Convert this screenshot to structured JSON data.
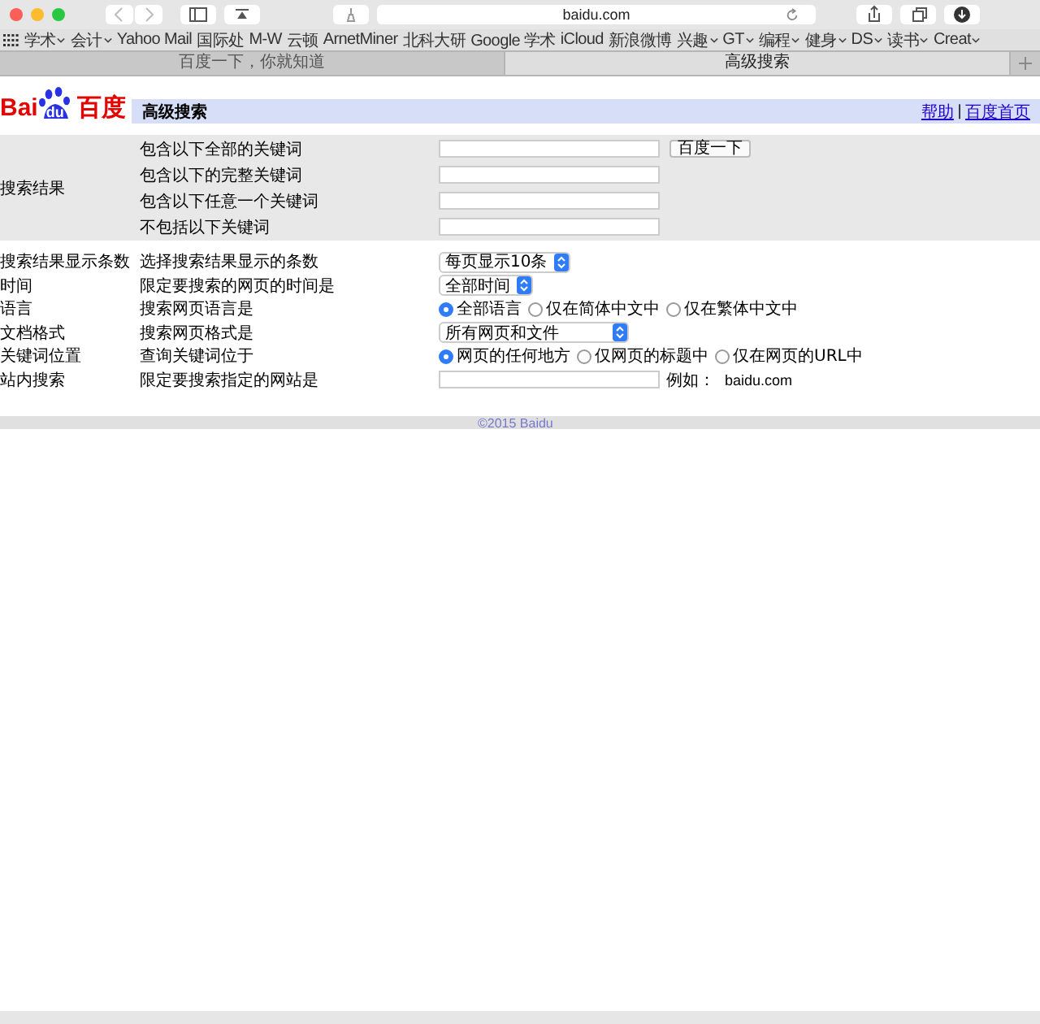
{
  "browser": {
    "url": "baidu.com"
  },
  "bookmarks": [
    {
      "label": "学术",
      "menu": true
    },
    {
      "label": "会计",
      "menu": true
    },
    {
      "label": "Yahoo Mail",
      "menu": false
    },
    {
      "label": "国际处",
      "menu": false
    },
    {
      "label": "M-W",
      "menu": false
    },
    {
      "label": "云顿",
      "menu": false
    },
    {
      "label": "ArnetMiner",
      "menu": false
    },
    {
      "label": "北科大研",
      "menu": false
    },
    {
      "label": "Google 学术",
      "menu": false
    },
    {
      "label": "iCloud",
      "menu": false
    },
    {
      "label": "新浪微博",
      "menu": false
    },
    {
      "label": "兴趣",
      "menu": true
    },
    {
      "label": "GT",
      "menu": true
    },
    {
      "label": "编程",
      "menu": true
    },
    {
      "label": "健身",
      "menu": true
    },
    {
      "label": "DS",
      "menu": true
    },
    {
      "label": "读书",
      "menu": true
    },
    {
      "label": "Creat",
      "menu": true
    }
  ],
  "tabs": [
    {
      "label": "百度一下，你就知道",
      "selected": false
    },
    {
      "label": "高级搜索",
      "selected": true
    }
  ],
  "logo": {
    "text_1": "Bai",
    "text_2": "du",
    "text_3": "百度"
  },
  "header": {
    "title": "高级搜索",
    "links": [
      "帮助",
      "百度首页"
    ],
    "separator": "|"
  },
  "keywords": {
    "label": "搜索结果",
    "button": "百度一下",
    "rows": [
      {
        "label": "包含以下全部的关键词"
      },
      {
        "label": "包含以下的完整关键词"
      },
      {
        "label": "包含以下任意一个关键词"
      },
      {
        "label": "不包括以下关键词"
      }
    ]
  },
  "options": [
    {
      "label": "搜索结果显示条数",
      "description": "选择搜索结果显示的条数",
      "kind": "select",
      "value": "每页显示10条"
    },
    {
      "label": "时间",
      "description": "限定要搜索的网页的时间是",
      "kind": "select",
      "value": "全部时间"
    },
    {
      "label": "语言",
      "description": "搜索网页语言是",
      "kind": "radio",
      "choices": [
        {
          "label": "全部语言",
          "selected": true
        },
        {
          "label": "仅在简体中文中",
          "selected": false
        },
        {
          "label": "仅在繁体中文中",
          "selected": false
        }
      ]
    },
    {
      "label": "文档格式",
      "description": "搜索网页格式是",
      "kind": "select",
      "value": "所有网页和文件"
    },
    {
      "label": "关键词位置",
      "description": "查询关键词位于",
      "kind": "radio",
      "choices": [
        {
          "label": "网页的任何地方",
          "selected": true
        },
        {
          "label": "仅网页的标题中",
          "selected": false
        },
        {
          "label": "仅在网页的URL中",
          "selected": false
        }
      ]
    },
    {
      "label": "站内搜索",
      "description": "限定要搜索指定的网站是",
      "kind": "input",
      "hint": "例如：",
      "example": "baidu.com"
    }
  ],
  "footer": "©2015 Baidu"
}
